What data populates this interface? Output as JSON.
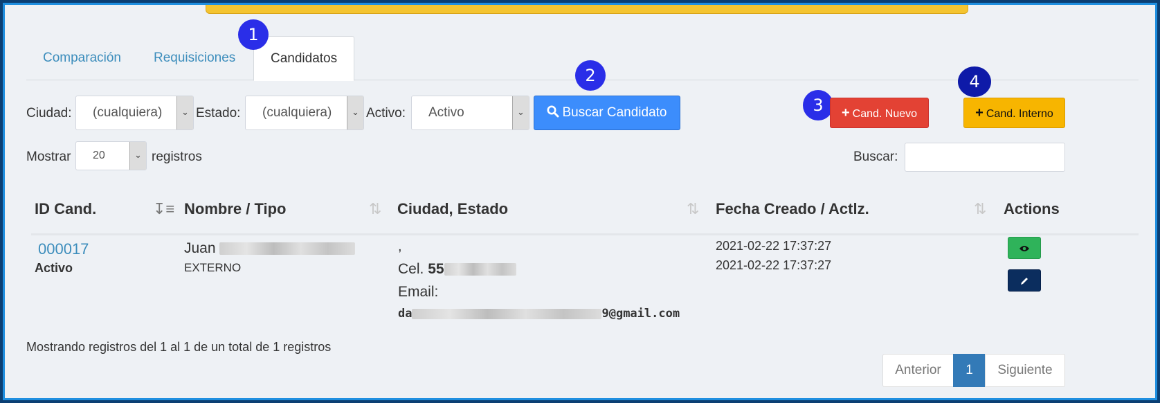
{
  "tabs": [
    {
      "label": "Comparación"
    },
    {
      "label": "Requisiciones"
    },
    {
      "label": "Candidatos"
    }
  ],
  "badges": [
    "1",
    "2",
    "3",
    "4"
  ],
  "filters": {
    "city_label": "Ciudad:",
    "city_value": "(cualquiera)",
    "state_label": "Estado:",
    "state_value": "(cualquiera)",
    "active_label": "Activo:",
    "active_value": "Activo",
    "search_button": "Buscar Candidato"
  },
  "actions": {
    "new_candidate": "Cand. Nuevo",
    "internal_candidate": "Cand. Interno"
  },
  "length": {
    "show_label": "Mostrar",
    "value": "20",
    "records_label": "registros",
    "search_label": "Buscar:"
  },
  "table": {
    "columns": [
      "ID Cand.",
      "Nombre / Tipo",
      "Ciudad, Estado",
      "Fecha Creado / Actlz.",
      "Actions"
    ],
    "rows": [
      {
        "id": "000017",
        "status": "Activo",
        "name_first": "Juan",
        "type": "EXTERNO",
        "city_state": ",",
        "phone_label": "Cel.",
        "phone_prefix": "55",
        "email_label": "Email:",
        "email_prefix": "da",
        "email_suffix": "9@gmail.com",
        "created": "2021-02-22 17:37:27",
        "updated": "2021-02-22 17:37:27"
      }
    ]
  },
  "footer": {
    "info": "Mostrando registros del 1 al 1 de un total de 1 registros",
    "prev": "Anterior",
    "page": "1",
    "next": "Siguiente"
  },
  "colors": {
    "primary": "#3c8dfc",
    "danger": "#e34234",
    "warning": "#f7b500",
    "view": "#2fb35a",
    "edit": "#0b2d5e"
  },
  "icons": {
    "search": "search-icon",
    "plus": "plus-icon",
    "view": "eye-icon",
    "edit": "pencil-icon"
  }
}
